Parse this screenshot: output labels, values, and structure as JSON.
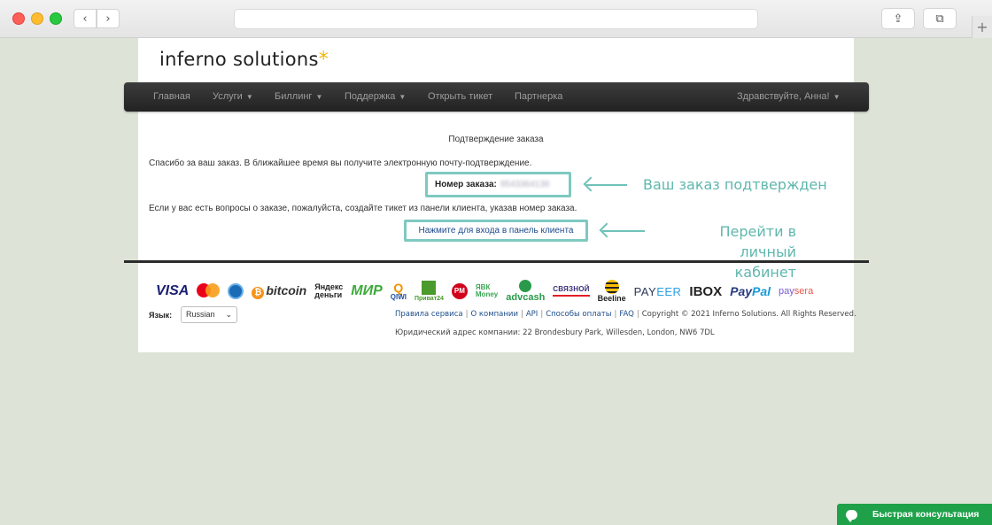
{
  "browser": {
    "back_glyph": "‹",
    "forward_glyph": "›",
    "share_glyph": "⇪",
    "tabs_glyph": "⧉",
    "newtab_glyph": "+"
  },
  "logo": {
    "text": "inferno solutions",
    "star": "*",
    "accent_color": "#f2b705"
  },
  "nav": {
    "items": [
      {
        "label": "Главная",
        "caret": ""
      },
      {
        "label": "Услуги",
        "caret": "▼"
      },
      {
        "label": "Биллинг",
        "caret": "▼"
      },
      {
        "label": "Поддержка",
        "caret": "▼"
      },
      {
        "label": "Открыть тикет",
        "caret": ""
      },
      {
        "label": "Партнерка",
        "caret": ""
      }
    ],
    "user": {
      "label": "Здравствуйте, Анна!",
      "caret": "▼"
    }
  },
  "content": {
    "heading": "Подтверждение заказа",
    "thanks": "Спасибо за ваш заказ. В ближайшее время вы получите электронную почту-подтверждение.",
    "order_label": "Номер заказа:",
    "order_number": "9543364136",
    "questions": "Если у вас есть вопросы о заказе, пожалуйста, создайте тикет из панели клиента, указав номер заказа.",
    "login_link": "Нажмите для входа в панель клиента"
  },
  "annotations": {
    "order_confirmed": "Ваш заказ подтвержден",
    "go_cabinet_1": "Перейти в личный",
    "go_cabinet_2": "кабинет",
    "color": "#5fb7ad"
  },
  "payments": {
    "visa": "VISA",
    "bitcoin": "bitcoin",
    "btc_symbol": "₿",
    "yandex_top": "Яндекс",
    "yandex_bottom": "деньги",
    "mir": "МИР",
    "qiwi_symbol": "Q",
    "qiwi": "QIWI",
    "privat": "Приват24",
    "pm": "PM",
    "yabk_top": "ЯВК",
    "yabk_bottom": "Money",
    "advcash": "advcash",
    "svyaznoy": "СВЯЗНОЙ",
    "beeline": "Beeline",
    "payeer_a": "PAY",
    "payeer_b": "EER",
    "ibox": "IBOX",
    "paypal_a": "Pay",
    "paypal_b": "Pal",
    "paysera_a": "pay",
    "paysera_b": "sera"
  },
  "footer": {
    "lang_label": "Язык:",
    "lang_value": "Russian",
    "lang_chevron": "⌄",
    "links": [
      "Правила сервиса",
      "О компании",
      "API",
      "Способы оплаты",
      "FAQ"
    ],
    "copyright": "Copyright © 2021 Inferno Solutions. All Rights Reserved.",
    "address": "Юридический адрес компании: 22 Brondesbury Park, Willesden, London, NW6 7DL"
  },
  "chat": {
    "label": "Быстрая консультация",
    "color": "#1fa14a"
  }
}
